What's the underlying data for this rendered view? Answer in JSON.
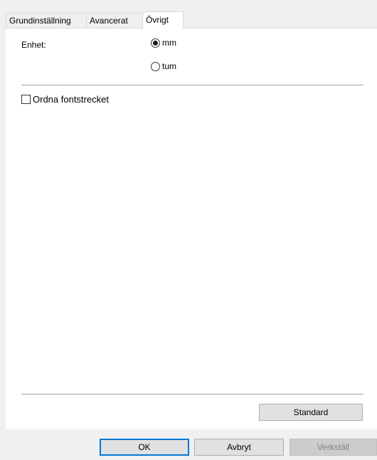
{
  "tabs": [
    {
      "label": "Grundinställning",
      "active": false
    },
    {
      "label": "Avancerat",
      "active": false
    },
    {
      "label": "Övrigt",
      "active": true
    }
  ],
  "unit": {
    "label": "Enhet:",
    "options": [
      {
        "label": "mm",
        "checked": true
      },
      {
        "label": "tum",
        "checked": false
      }
    ]
  },
  "checkbox": {
    "label": "Ordna fontstrecket",
    "checked": false
  },
  "buttons": {
    "standard": "Standard",
    "ok": "OK",
    "cancel": "Avbryt",
    "apply": "Verkställ",
    "apply_enabled": false
  },
  "colors": {
    "window_bg": "#f0f0f0",
    "panel_bg": "#ffffff",
    "default_button_border": "#0078d7",
    "disabled_text": "#838383"
  }
}
